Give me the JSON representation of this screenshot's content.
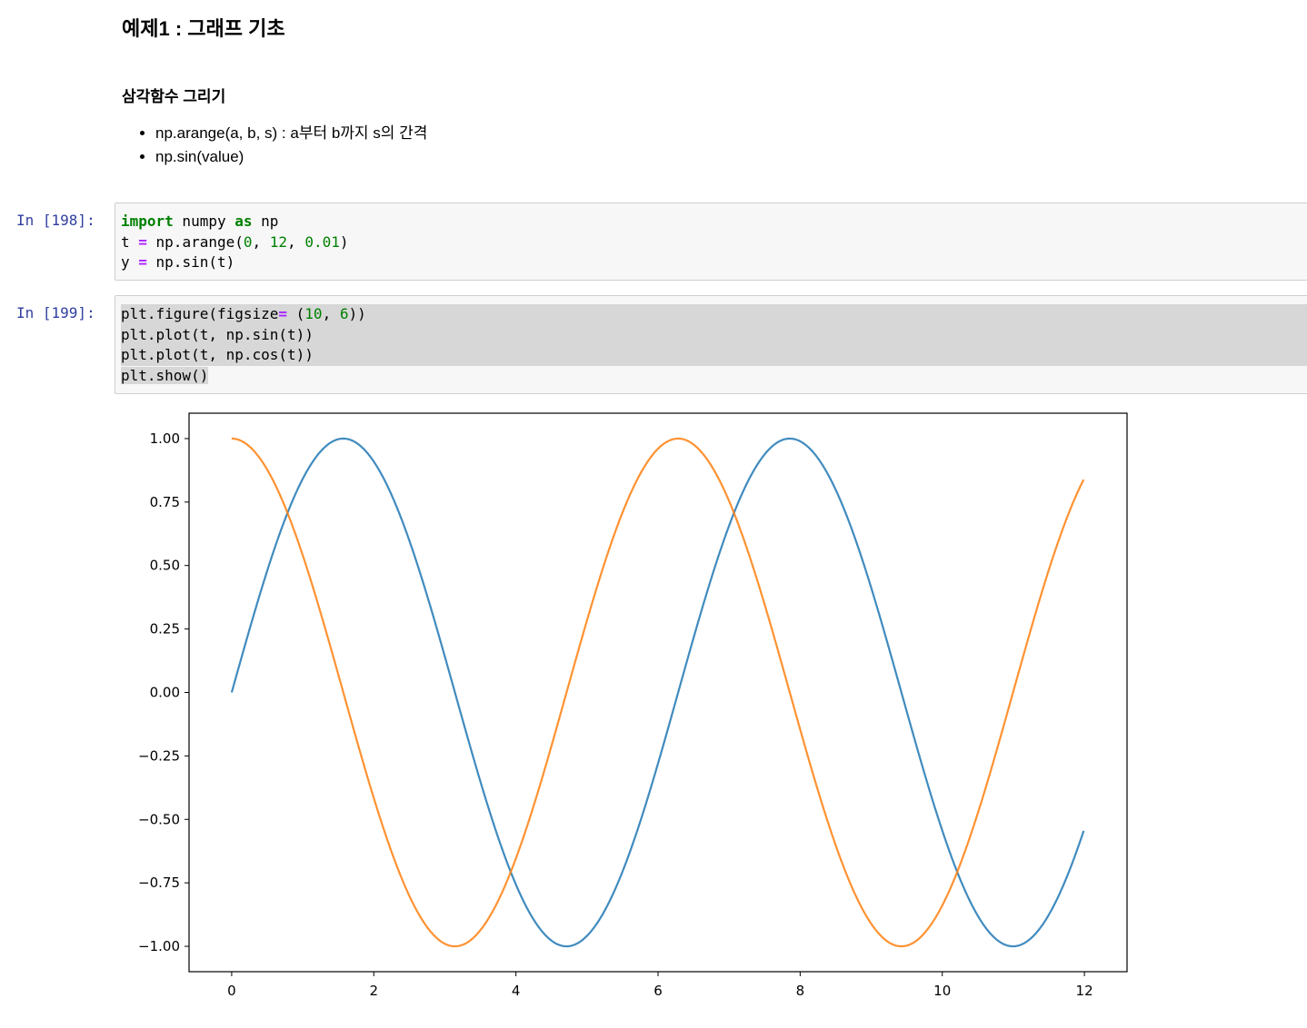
{
  "markdown": {
    "heading": "예제1 : 그래프 기초",
    "subheading": "삼각함수 그리기",
    "bullets": [
      "np.arange(a, b, s) : a부터 b까지 s의 간격",
      "np.sin(value)"
    ]
  },
  "cells": [
    {
      "prompt": "In [198]:",
      "lines": [
        [
          {
            "t": "import",
            "c": "kw"
          },
          {
            "t": " numpy "
          },
          {
            "t": "as",
            "c": "kw"
          },
          {
            "t": " np"
          }
        ],
        [
          {
            "t": "t "
          },
          {
            "t": "=",
            "c": "op"
          },
          {
            "t": " np.arange("
          },
          {
            "t": "0",
            "c": "num"
          },
          {
            "t": ", "
          },
          {
            "t": "12",
            "c": "num"
          },
          {
            "t": ", "
          },
          {
            "t": "0.01",
            "c": "num"
          },
          {
            "t": ")"
          }
        ],
        [
          {
            "t": "y "
          },
          {
            "t": "=",
            "c": "op"
          },
          {
            "t": " np.sin(t)"
          }
        ]
      ]
    },
    {
      "prompt": "In [199]:",
      "lines": [
        [
          {
            "t": "plt.figure(figsize"
          },
          {
            "t": "=",
            "c": "op"
          },
          {
            "t": " ("
          },
          {
            "t": "10",
            "c": "num"
          },
          {
            "t": ", "
          },
          {
            "t": "6",
            "c": "num"
          },
          {
            "t": "))"
          }
        ],
        [
          {
            "t": "plt.plot(t, np.sin(t))"
          }
        ],
        [
          {
            "t": "plt.plot(t, np.cos(t))"
          }
        ],
        [
          {
            "t": "plt.show()"
          }
        ]
      ]
    }
  ],
  "chart_data": {
    "type": "line",
    "title": "",
    "xlabel": "",
    "ylabel": "",
    "xlim": [
      -0.6,
      12.6
    ],
    "ylim": [
      -1.1,
      1.1
    ],
    "xticks": [
      0,
      2,
      4,
      6,
      8,
      10,
      12
    ],
    "xtick_labels": [
      "0",
      "2",
      "4",
      "6",
      "8",
      "10",
      "12"
    ],
    "yticks": [
      1.0,
      0.75,
      0.5,
      0.25,
      0.0,
      -0.25,
      -0.5,
      -0.75,
      -1.0
    ],
    "ytick_labels": [
      "1.00",
      "0.75",
      "0.50",
      "0.25",
      "0.00",
      "−0.25",
      "−0.50",
      "−0.75",
      "−1.00"
    ],
    "grid": false,
    "x": {
      "start": 0,
      "stop": 12,
      "step": 0.01
    },
    "series": [
      {
        "function": "sin",
        "color": "#1f77b4"
      },
      {
        "function": "cos",
        "color": "#ff7f0e"
      }
    ]
  }
}
